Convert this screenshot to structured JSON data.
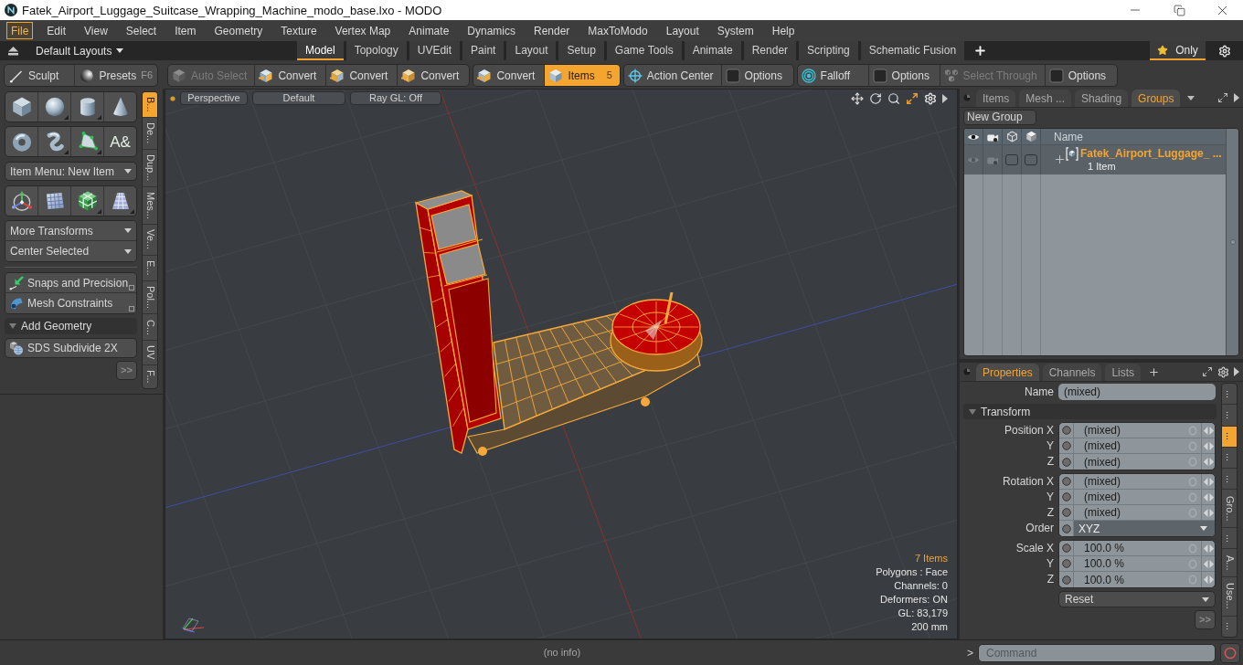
{
  "window": {
    "title": "Fatek_Airport_Luggage_Suitcase_Wrapping_Machine_modo_base.lxo - MODO"
  },
  "menu_bar": [
    {
      "label": "File",
      "selected": true
    },
    {
      "label": "Edit",
      "selected": false
    },
    {
      "label": "View",
      "selected": false
    },
    {
      "label": "Select",
      "selected": false
    },
    {
      "label": "Item",
      "selected": false
    },
    {
      "label": "Geometry",
      "selected": false
    },
    {
      "label": "Texture",
      "selected": false
    },
    {
      "label": "Vertex Map",
      "selected": false
    },
    {
      "label": "Animate",
      "selected": false
    },
    {
      "label": "Dynamics",
      "selected": false
    },
    {
      "label": "Render",
      "selected": false
    },
    {
      "label": "MaxToModo",
      "selected": false
    },
    {
      "label": "Layout",
      "selected": false
    },
    {
      "label": "System",
      "selected": false
    },
    {
      "label": "Help",
      "selected": false
    }
  ],
  "layout_bar": {
    "layouts_menu": "Default Layouts",
    "tabs": [
      {
        "label": "Model",
        "selected": true
      },
      {
        "label": "Topology",
        "selected": false
      },
      {
        "label": "UVEdit",
        "selected": false
      },
      {
        "label": "Paint",
        "selected": false
      },
      {
        "label": "Layout",
        "selected": false
      },
      {
        "label": "Setup",
        "selected": false
      },
      {
        "label": "Game Tools",
        "selected": false
      },
      {
        "label": "Animate",
        "selected": false
      },
      {
        "label": "Render",
        "selected": false
      },
      {
        "label": "Scripting",
        "selected": false
      },
      {
        "label": "Schematic Fusion",
        "selected": false
      }
    ],
    "filter": {
      "label": "Only",
      "selected": true
    }
  },
  "toolbar": {
    "brushes": [
      {
        "label": "Sculpt"
      },
      {
        "label": "Presets",
        "shortcut": "F6"
      }
    ],
    "groups": [
      {
        "tools": [
          {
            "label": "Auto Select",
            "selected": false,
            "disabled": true
          },
          {
            "label": "Convert",
            "selected": false,
            "disabled": false
          },
          {
            "label": "Convert",
            "selected": false,
            "disabled": false
          },
          {
            "label": "Convert",
            "selected": false,
            "disabled": false
          }
        ]
      },
      {
        "tools": [
          {
            "label": "Convert",
            "selected": false,
            "disabled": false
          },
          {
            "label": "Items",
            "selected": true,
            "disabled": false,
            "badge": "5"
          }
        ]
      },
      {
        "tools": [
          {
            "label": "Action Center",
            "selected": false,
            "disabled": false
          },
          {
            "label": "Options",
            "selected": false,
            "disabled": false
          }
        ]
      },
      {
        "tools": [
          {
            "label": "Falloff",
            "selected": false,
            "disabled": false
          },
          {
            "label": "Options",
            "selected": false,
            "disabled": false
          },
          {
            "label": "Select Through",
            "selected": false,
            "disabled": true
          },
          {
            "label": "Options",
            "selected": false,
            "disabled": false
          }
        ]
      }
    ]
  },
  "left_panel": {
    "text_tool_glyph": "A&",
    "item_menu": "Item Menu: New Item",
    "transform_menus": [
      "More Transforms",
      "Center Selected"
    ],
    "tools": [
      "Snaps and Precision",
      "Mesh Constraints"
    ],
    "section": {
      "label": "Add Geometry",
      "expanded": true
    },
    "geometry_tools": [
      "SDS Subdivide 2X"
    ],
    "more_button": ">>",
    "side_tabs": [
      {
        "label": "B...",
        "selected": true
      },
      {
        "label": "De...",
        "selected": false
      },
      {
        "label": "Dup...",
        "selected": false
      },
      {
        "label": "Mes...",
        "selected": false
      },
      {
        "label": "Ve...",
        "selected": false
      },
      {
        "label": "E...",
        "selected": false
      },
      {
        "label": "Pol...",
        "selected": false
      },
      {
        "label": "C...",
        "selected": false
      },
      {
        "label": "UV",
        "selected": false
      },
      {
        "label": "F...",
        "selected": false
      }
    ]
  },
  "viewport": {
    "view_buttons": [
      "Perspective",
      "Default",
      "Ray GL: Off"
    ],
    "stats": [
      {
        "text": "7 Items",
        "highlighted": true
      },
      {
        "text": "Polygons : Face",
        "highlighted": false
      },
      {
        "text": "Channels: 0",
        "highlighted": false
      },
      {
        "text": "Deformers: ON",
        "highlighted": false
      },
      {
        "text": "GL: 83,179",
        "highlighted": false
      },
      {
        "text": "200 mm",
        "highlighted": false
      }
    ]
  },
  "groups_panel": {
    "tabs": [
      {
        "label": "Items",
        "selected": false
      },
      {
        "label": "Mesh ...",
        "selected": false
      },
      {
        "label": "Shading",
        "selected": false
      },
      {
        "label": "Groups",
        "selected": true
      }
    ],
    "new_group": "New Group",
    "name_column": "Name",
    "rows": [
      {
        "name": "Fatek_Airport_Luggage_ ...",
        "count": "1 Item",
        "expanded": false,
        "toggles": [
          {
            "checked": false
          },
          {
            "checked": false
          }
        ]
      }
    ]
  },
  "properties_panel": {
    "tabs": [
      {
        "label": "Properties",
        "selected": true
      },
      {
        "label": "Channels",
        "selected": false
      },
      {
        "label": "Lists",
        "selected": false
      }
    ],
    "name_field": {
      "label": "Name",
      "value": "(mixed)"
    },
    "section": {
      "label": "Transform",
      "expanded": true
    },
    "groups": [
      {
        "fields": [
          {
            "label": "Position X",
            "value": "(mixed)",
            "kind": "number"
          },
          {
            "label": "Y",
            "value": "(mixed)",
            "kind": "number"
          },
          {
            "label": "Z",
            "value": "(mixed)",
            "kind": "number"
          }
        ]
      },
      {
        "fields": [
          {
            "label": "Rotation X",
            "value": "(mixed)",
            "kind": "number"
          },
          {
            "label": "Y",
            "value": "(mixed)",
            "kind": "number"
          },
          {
            "label": "Z",
            "value": "(mixed)",
            "kind": "number"
          },
          {
            "label": "Order",
            "value": "XYZ",
            "kind": "dropdown"
          }
        ]
      },
      {
        "fields": [
          {
            "label": "Scale X",
            "value": "100.0 %",
            "kind": "number"
          },
          {
            "label": "Y",
            "value": "100.0 %",
            "kind": "number"
          },
          {
            "label": "Z",
            "value": "100.0 %",
            "kind": "number"
          }
        ]
      }
    ],
    "reset_menu": "Reset",
    "more_button": ">>",
    "side_tabs": [
      {
        "label": "...",
        "selected": false
      },
      {
        "label": "...",
        "selected": false
      },
      {
        "label": "...",
        "selected": true
      },
      {
        "label": "...",
        "selected": false
      },
      {
        "label": "...",
        "selected": false
      },
      {
        "label": "Gro...",
        "selected": false
      },
      {
        "label": "...",
        "selected": false
      },
      {
        "label": "A...",
        "selected": false
      },
      {
        "label": "Use...",
        "selected": false
      },
      {
        "label": "...",
        "selected": false
      }
    ]
  },
  "status_bar": {
    "info": "(no info)",
    "command_prompt": ">",
    "command_placeholder": "Command"
  }
}
